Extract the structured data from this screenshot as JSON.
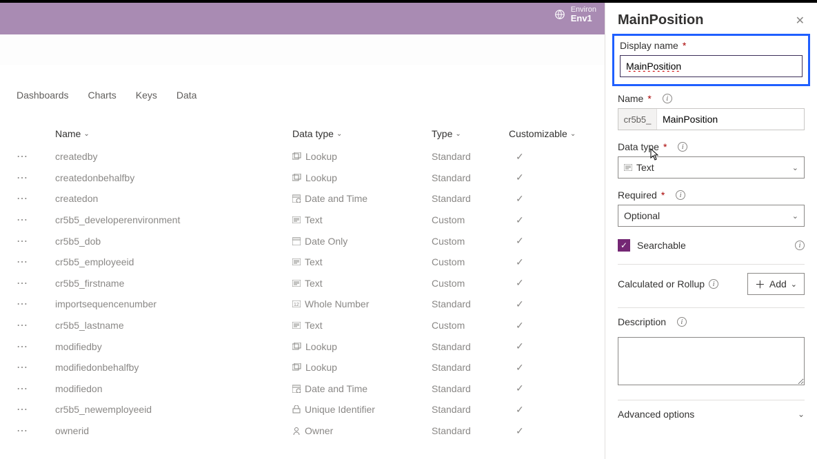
{
  "header": {
    "env_label": "Environ",
    "env_name": "Env1"
  },
  "tabs": [
    "Dashboards",
    "Charts",
    "Keys",
    "Data"
  ],
  "columns": {
    "name": "Name",
    "datatype": "Data type",
    "type": "Type",
    "customizable": "Customizable"
  },
  "rows": [
    {
      "name": "createdby",
      "datatype": "Lookup",
      "dt_icon": "lookup",
      "type": "Standard",
      "cust": true
    },
    {
      "name": "createdonbehalfby",
      "datatype": "Lookup",
      "dt_icon": "lookup",
      "type": "Standard",
      "cust": true
    },
    {
      "name": "createdon",
      "datatype": "Date and Time",
      "dt_icon": "datetime",
      "type": "Standard",
      "cust": true
    },
    {
      "name": "cr5b5_developerenvironment",
      "datatype": "Text",
      "dt_icon": "text",
      "type": "Custom",
      "cust": true
    },
    {
      "name": "cr5b5_dob",
      "datatype": "Date Only",
      "dt_icon": "dateonly",
      "type": "Custom",
      "cust": true
    },
    {
      "name": "cr5b5_employeeid",
      "datatype": "Text",
      "dt_icon": "text",
      "type": "Custom",
      "cust": true
    },
    {
      "name": "cr5b5_firstname",
      "datatype": "Text",
      "dt_icon": "text",
      "type": "Custom",
      "cust": true
    },
    {
      "name": "importsequencenumber",
      "datatype": "Whole Number",
      "dt_icon": "number",
      "type": "Standard",
      "cust": true
    },
    {
      "name": "cr5b5_lastname",
      "datatype": "Text",
      "dt_icon": "text",
      "type": "Custom",
      "cust": true
    },
    {
      "name": "modifiedby",
      "datatype": "Lookup",
      "dt_icon": "lookup",
      "type": "Standard",
      "cust": true
    },
    {
      "name": "modifiedonbehalfby",
      "datatype": "Lookup",
      "dt_icon": "lookup",
      "type": "Standard",
      "cust": true
    },
    {
      "name": "modifiedon",
      "datatype": "Date and Time",
      "dt_icon": "datetime",
      "type": "Standard",
      "cust": true
    },
    {
      "name": "cr5b5_newemployeeid",
      "datatype": "Unique Identifier",
      "dt_icon": "unique",
      "type": "Standard",
      "cust": true
    },
    {
      "name": "ownerid",
      "datatype": "Owner",
      "dt_icon": "owner",
      "type": "Standard",
      "cust": true
    }
  ],
  "panel": {
    "title": "MainPosition",
    "display_name_label": "Display name",
    "display_name_value": "MainPosition",
    "name_label": "Name",
    "name_prefix": "cr5b5_",
    "name_value": "MainPosition",
    "datatype_label": "Data type",
    "datatype_value": "Text",
    "required_label": "Required",
    "required_value": "Optional",
    "searchable_label": "Searchable",
    "searchable_checked": true,
    "calc_label": "Calculated or Rollup",
    "add_label": "Add",
    "description_label": "Description",
    "advanced_label": "Advanced options"
  }
}
